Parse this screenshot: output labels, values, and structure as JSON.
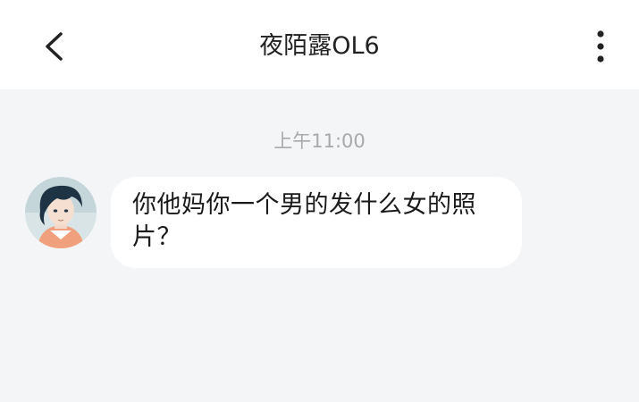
{
  "header": {
    "title": "夜陌露OL6",
    "back_icon": "chevron-left-icon",
    "more_icon": "more-vertical-icon"
  },
  "conversation": {
    "timestamp": "上午11:00",
    "messages": [
      {
        "text": "你他妈你一个男的发什么女的照片？",
        "avatar": "anime-boy-avatar"
      }
    ]
  },
  "colors": {
    "header_bg": "#ffffff",
    "chat_bg": "#f4f5f7",
    "bubble_bg": "#ffffff",
    "timestamp": "#a9a9a9",
    "text": "#1a1a1a"
  }
}
